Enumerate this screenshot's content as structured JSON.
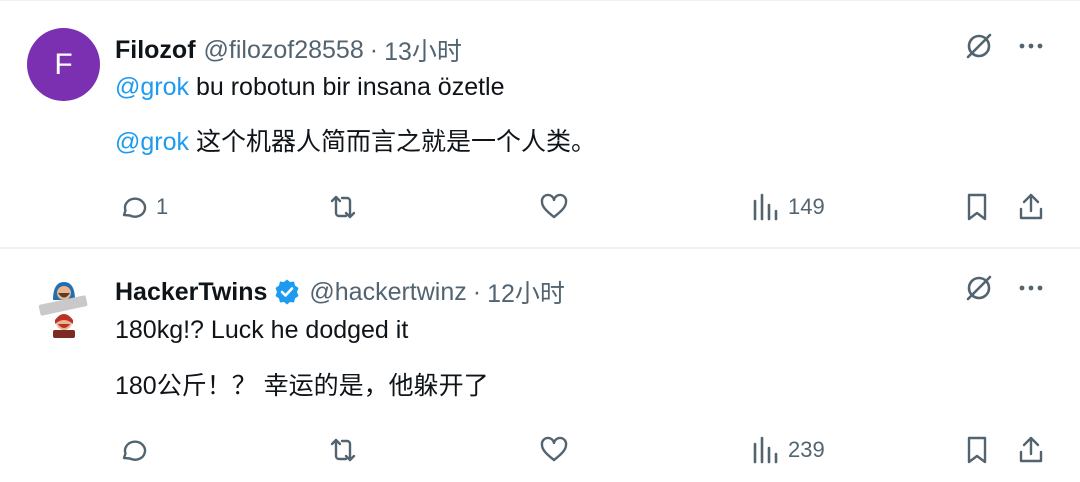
{
  "tweets": [
    {
      "avatar_letter": "F",
      "avatar_color": "#7b2fb1",
      "name": "Filozof",
      "handle": "@filozof28558",
      "separator": "·",
      "time": "13小时",
      "lines": [
        {
          "mention": "@grok",
          "text": " bu robotun bir insana özetle"
        },
        {
          "mention": "@grok",
          "text": " 这个机器人简而言之就是一个人类。"
        }
      ],
      "replies": "1",
      "retweets": "",
      "likes": "",
      "views": "149"
    },
    {
      "name": "HackerTwins",
      "verified": true,
      "handle": "@hackertwinz",
      "separator": "·",
      "time": "12小时",
      "lines": [
        {
          "text": "180kg!? Luck he dodged it"
        },
        {
          "text": "180公斤！？ 幸运的是，他躲开了"
        }
      ],
      "replies": "",
      "retweets": "",
      "likes": "",
      "views": "239"
    }
  ],
  "colors": {
    "text_primary": "#0f1419",
    "text_secondary": "#536471",
    "mention": "#1d9bf0",
    "verified": "#1d9bf0"
  },
  "icons": [
    "reply-icon",
    "retweet-icon",
    "like-icon",
    "views-icon",
    "bookmark-icon",
    "share-icon",
    "grok-icon",
    "more-icon",
    "verified-badge-icon"
  ]
}
